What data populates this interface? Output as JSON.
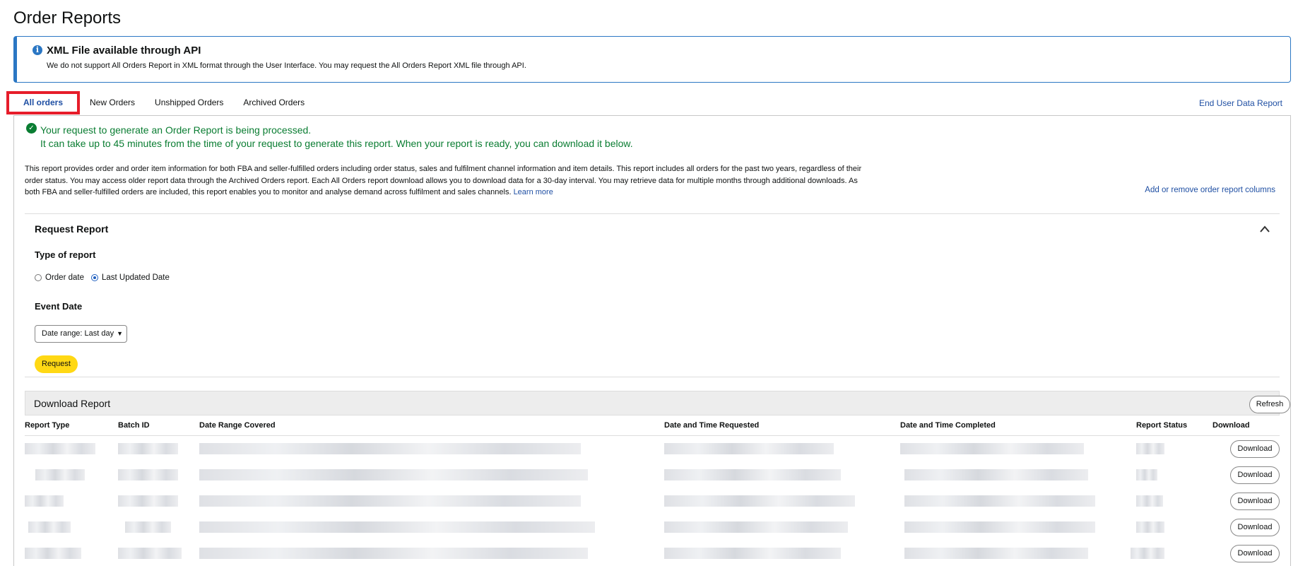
{
  "page": {
    "title": "Order Reports"
  },
  "info": {
    "title": "XML File available through API",
    "text": "We do not support All Orders Report in XML format through the User Interface. You may request the All Orders Report XML file through API."
  },
  "tabs": [
    {
      "label": "All orders",
      "active": true
    },
    {
      "label": "New Orders"
    },
    {
      "label": "Unshipped Orders"
    },
    {
      "label": "Archived Orders"
    }
  ],
  "end_user_link": "End User Data Report",
  "success": {
    "line1": "Your request to generate an Order Report is being processed.",
    "line2": "It can take up to 45 minutes from the time of your request to generate this report. When your report is ready, you can download it below."
  },
  "description": {
    "text": "This report provides order and order item information for both FBA and seller-fulfilled orders including order status, sales and fulfilment channel information and item details. This report includes all orders for the past two years, regardless of their order status. You may access older report data through the Archived Orders report. Each All Orders report download allows you to download data for a 30-day interval. You may retrieve data for multiple months through additional downloads. As both FBA and seller-fulfilled orders are included, this report enables you to monitor and analyse demand across fulfilment and sales channels.",
    "learn_more": "Learn more"
  },
  "add_columns_link": "Add or remove order report columns",
  "request_report": {
    "title": "Request Report",
    "type_label": "Type of report",
    "options": [
      "Order date",
      "Last Updated Date"
    ],
    "selected": "Last Updated Date",
    "event_label": "Event Date",
    "date_range": "Date range: Last day",
    "request_button": "Request"
  },
  "download_report": {
    "title": "Download Report",
    "refresh_button": "Refresh",
    "columns": [
      "Report Type",
      "Batch ID",
      "Date Range Covered",
      "Date and Time Requested",
      "Date and Time Completed",
      "Report Status",
      "Download"
    ],
    "download_button": "Download"
  },
  "colors": {
    "accent_blue": "#1f4fa3",
    "success_green": "#0a7d32",
    "button_yellow": "#ffd814",
    "highlight_red": "#e61d2a"
  },
  "icons": [
    "info-icon",
    "check-circle-icon",
    "chevron-up-icon",
    "dropdown-caret-icon"
  ]
}
